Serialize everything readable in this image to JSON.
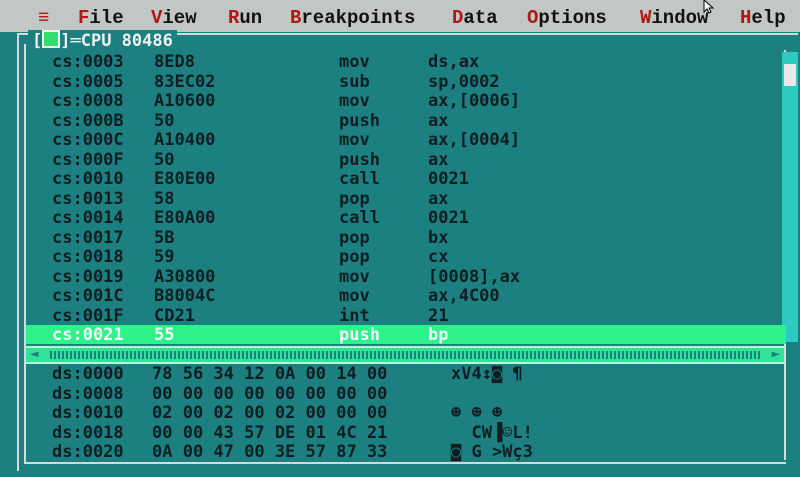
{
  "menu": {
    "system": "≡",
    "items": [
      {
        "hot": "F",
        "rest": "ile"
      },
      {
        "hot": "V",
        "rest": "iew"
      },
      {
        "hot": "R",
        "rest": "un"
      },
      {
        "hot": "B",
        "rest": "reakpoints"
      },
      {
        "hot": "D",
        "rest": "ata"
      },
      {
        "hot": "O",
        "rest": "ptions"
      },
      {
        "hot": "W",
        "rest": "indow"
      },
      {
        "hot": "H",
        "rest": "elp"
      }
    ]
  },
  "window": {
    "close_box": "■",
    "title": "CPU 80486"
  },
  "code": [
    {
      "addr": "cs:0003",
      "bytes": "8ED8",
      "mnemonic": "mov",
      "operands": "ds,ax"
    },
    {
      "addr": "cs:0005",
      "bytes": "83EC02",
      "mnemonic": "sub",
      "operands": "sp,0002"
    },
    {
      "addr": "cs:0008",
      "bytes": "A10600",
      "mnemonic": "mov",
      "operands": "ax,[0006]"
    },
    {
      "addr": "cs:000B",
      "bytes": "50",
      "mnemonic": "push",
      "operands": "ax"
    },
    {
      "addr": "cs:000C",
      "bytes": "A10400",
      "mnemonic": "mov",
      "operands": "ax,[0004]"
    },
    {
      "addr": "cs:000F",
      "bytes": "50",
      "mnemonic": "push",
      "operands": "ax"
    },
    {
      "addr": "cs:0010",
      "bytes": "E80E00",
      "mnemonic": "call",
      "operands": "0021"
    },
    {
      "addr": "cs:0013",
      "bytes": "58",
      "mnemonic": "pop",
      "operands": "ax"
    },
    {
      "addr": "cs:0014",
      "bytes": "E80A00",
      "mnemonic": "call",
      "operands": "0021"
    },
    {
      "addr": "cs:0017",
      "bytes": "5B",
      "mnemonic": "pop",
      "operands": "bx"
    },
    {
      "addr": "cs:0018",
      "bytes": "59",
      "mnemonic": "pop",
      "operands": "cx"
    },
    {
      "addr": "cs:0019",
      "bytes": "A30800",
      "mnemonic": "mov",
      "operands": "[0008],ax"
    },
    {
      "addr": "cs:001C",
      "bytes": "B8004C",
      "mnemonic": "mov",
      "operands": "ax,4C00"
    },
    {
      "addr": "cs:001F",
      "bytes": "CD21",
      "mnemonic": "int",
      "operands": "21"
    },
    {
      "addr": "cs:0021",
      "bytes": "55",
      "mnemonic": "push",
      "operands": "bp",
      "current": true
    }
  ],
  "dump": [
    {
      "addr": "ds:0000",
      "bytes": "78 56 34 12 0A 00 14 00",
      "ascii": "xV4↕◙ ¶"
    },
    {
      "addr": "ds:0008",
      "bytes": "00 00 00 00 00 00 00 00",
      "ascii": ""
    },
    {
      "addr": "ds:0010",
      "bytes": "02 00 02 00 02 00 00 00",
      "ascii": "☻ ☻ ☻"
    },
    {
      "addr": "ds:0018",
      "bytes": "00 00 43 57 DE 01 4C 21",
      "ascii": "  CW▐☺L!"
    },
    {
      "addr": "ds:0020",
      "bytes": "0A 00 47 00 3E 57 87 33",
      "ascii": "◙ G >Wç3"
    }
  ],
  "scroll": {
    "left_arrow": "◄",
    "right_arrow": "►"
  },
  "colors": {
    "background": "#1c7f80",
    "menubar": "#c2c6c4",
    "highlight": "#2ef38a",
    "hotkey": "#b01818"
  }
}
